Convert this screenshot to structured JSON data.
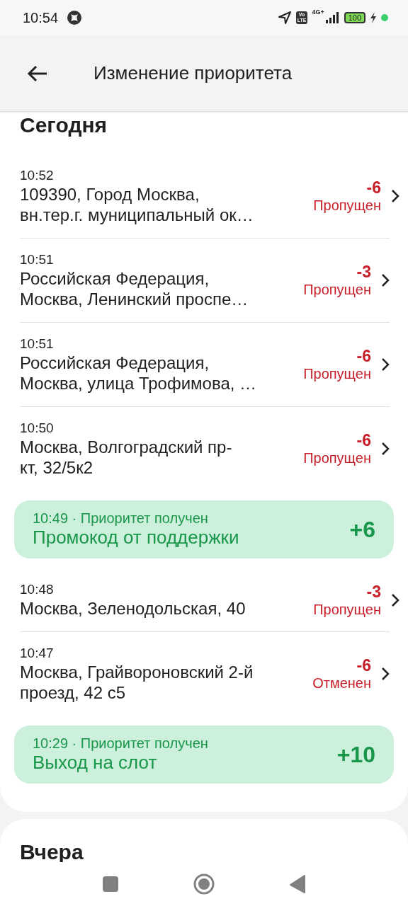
{
  "status_bar": {
    "time": "10:54",
    "volte": [
      "Vo",
      "LTE"
    ],
    "network": "4G+",
    "battery": "100"
  },
  "header": {
    "title": "Изменение приоритета"
  },
  "sections": [
    {
      "title": "Сегодня",
      "items": [
        {
          "kind": "order",
          "time": "10:52",
          "address_lines": [
            "109390, Город Москва,",
            "вн.тер.г. муниципальный ок…"
          ],
          "points": "-6",
          "status": "Пропущен"
        },
        {
          "kind": "order",
          "time": "10:51",
          "address_lines": [
            "Российская Федерация,",
            "Москва, Ленинский проспе…"
          ],
          "points": "-3",
          "status": "Пропущен"
        },
        {
          "kind": "order",
          "time": "10:51",
          "address_lines": [
            "Российская Федерация,",
            "Москва, улица Трофимова, …"
          ],
          "points": "-6",
          "status": "Пропущен"
        },
        {
          "kind": "order",
          "time": "10:50",
          "address_lines": [
            "Москва, Волгоградский пр-",
            "кт, 32/5к2"
          ],
          "points": "-6",
          "status": "Пропущен"
        },
        {
          "kind": "bonus",
          "time": "10:49",
          "separator": "·",
          "label": "Приоритет получен",
          "title": "Промокод от поддержки",
          "points": "+6"
        },
        {
          "kind": "order",
          "time": "10:48",
          "address_lines": [
            "Москва, Зеленодольская, 40"
          ],
          "points": "-3",
          "status": "Пропущен"
        },
        {
          "kind": "order",
          "time": "10:47",
          "address_lines": [
            "Москва, Грайвороновский 2-й",
            "проезд, 42 с5"
          ],
          "points": "-6",
          "status": "Отменен"
        },
        {
          "kind": "bonus",
          "time": "10:29",
          "separator": "·",
          "label": "Приоритет получен",
          "title": "Выход на слот",
          "points": "+10"
        }
      ]
    },
    {
      "title": "Вчера"
    }
  ]
}
